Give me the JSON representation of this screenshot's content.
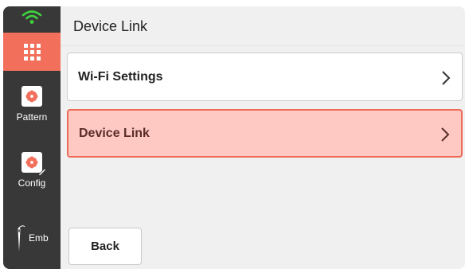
{
  "header": {
    "title": "Device Link"
  },
  "sidebar": {
    "items": [
      {
        "label": "Pattern",
        "icon": "pattern-icon"
      },
      {
        "label": "Config",
        "icon": "config-icon"
      },
      {
        "label": "Emb",
        "icon": "needle-icon"
      }
    ],
    "menu_icon": "grid-icon",
    "status_icon": "wifi-icon"
  },
  "list": {
    "items": [
      {
        "label": "Wi-Fi Settings",
        "selected": false
      },
      {
        "label": "Device Link",
        "selected": true
      }
    ]
  },
  "footer": {
    "back_label": "Back"
  },
  "colors": {
    "sidebar": "#383838",
    "accent": "#f26f5c",
    "selected_bg": "#fdc9c2",
    "wifi": "#3ed13e",
    "background": "#f0f0f0"
  }
}
